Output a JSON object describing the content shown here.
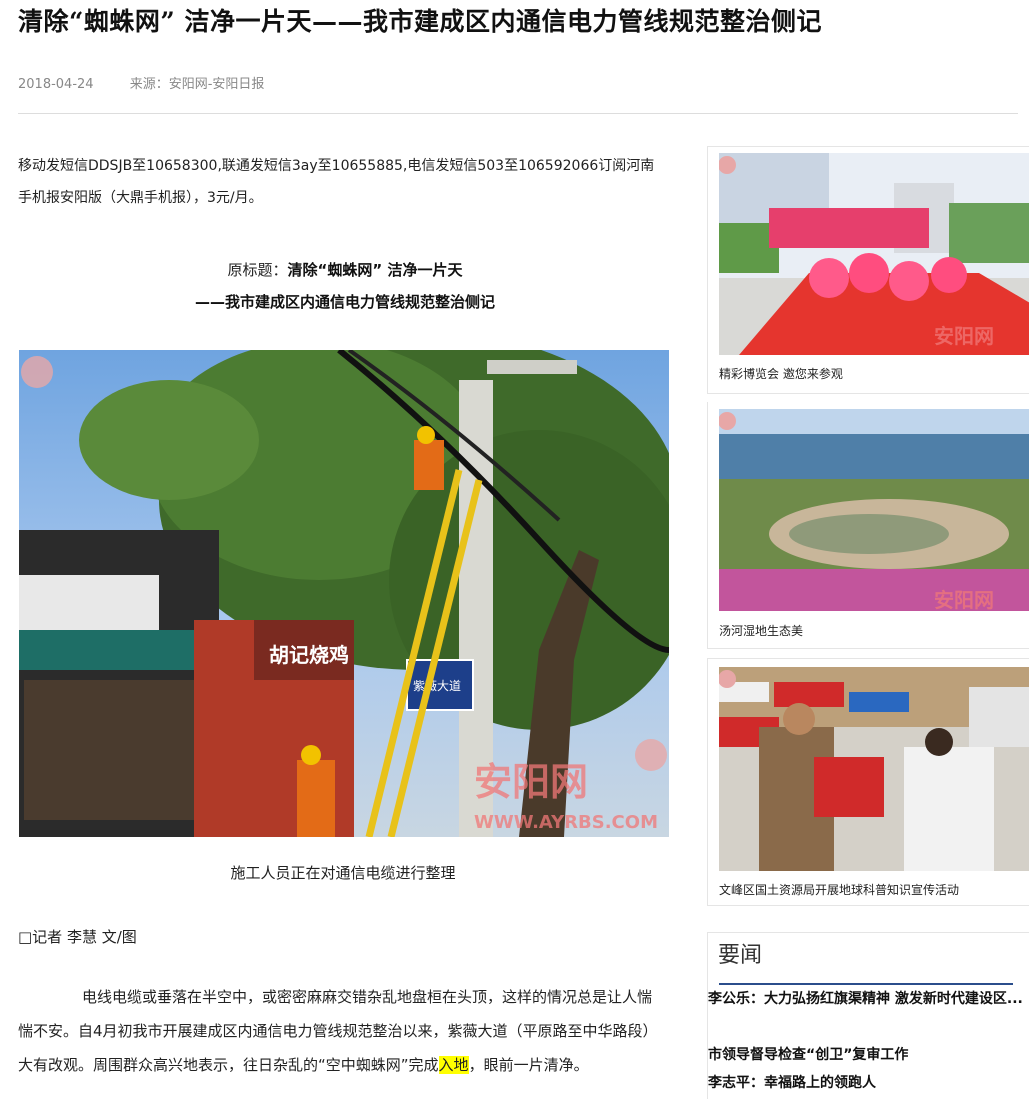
{
  "article": {
    "title": "清除“蜘蛛网” 洁净一片天——我市建成区内通信电力管线规范整治侧记",
    "date": "2018-04-24",
    "source_label": "来源：",
    "source": "安阳网-安阳日报",
    "sms_notice": "移动发短信DDSJB至10658300,联通发短信3ay至10655885,电信发短信503至106592066订阅河南手机报安阳版（大鼎手机报），3元/月。",
    "orig_title_label": "原标题：",
    "orig_title_line1": "清除“蜘蛛网” 洁净一片天",
    "orig_title_line2": "——我市建成区内通信电力管线规范整治侧记",
    "photo": {
      "sign_street": "紫薇大道",
      "shop_sign": "胡记烧鸡",
      "watermark": "安阳网",
      "watermark_url": "WWW.AYRBS.COM"
    },
    "caption": "施工人员正在对通信电缆进行整理",
    "byline": "□记者  李慧  文/图",
    "body_part1": "电线电缆或垂落在半空中，或密密麻麻交错杂乱地盘桓在头顶，这样的情况总是让人惴惴不安。自4月初我市开展建成区内通信电力管线规范整治以来，紫薇大道（平原路至中华路段）大有改观。周围群众高兴地表示，往日杂乱的“空中蜘蛛网”完成",
    "body_highlight": "入地",
    "body_part2": "，眼前一片清净。"
  },
  "sidebar": {
    "thumbs": [
      {
        "caption": "精彩博览会 邀您来参观"
      },
      {
        "caption": "汤河湿地生态美"
      },
      {
        "caption": "文峰区国土资源局开展地球科普知识宣传活动"
      }
    ],
    "watermark": "安阳网",
    "news_heading": "要闻",
    "news": [
      "李公乐：大力弘扬红旗渠精神 激发新时代建设区...",
      "市领导督导检查“创卫”复审工作",
      "李志平：幸福路上的领跑人"
    ]
  }
}
